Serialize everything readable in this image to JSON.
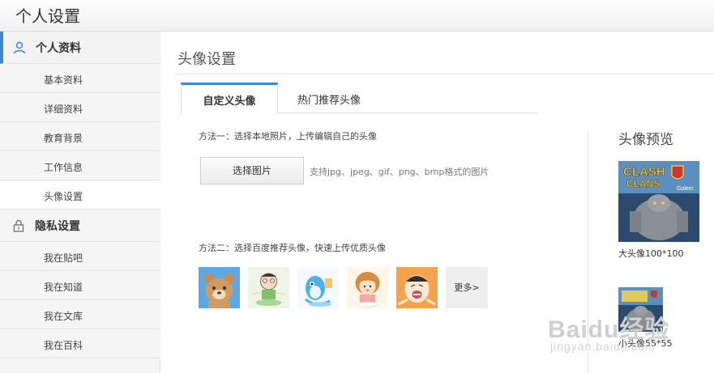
{
  "header": {
    "title": "个人设置"
  },
  "sidebar": {
    "sections": [
      {
        "label": "个人资料",
        "icon": "user-icon"
      },
      {
        "label": "隐私设置",
        "icon": "lock-icon"
      }
    ],
    "profile_items": [
      "基本资料",
      "详细资料",
      "教育背景",
      "工作信息",
      "头像设置"
    ],
    "privacy_items": [
      "我在贴吧",
      "我在知道",
      "我在文库",
      "我在百科"
    ],
    "selected": "头像设置"
  },
  "main": {
    "page_title": "头像设置",
    "tabs": [
      {
        "label": "自定义头像",
        "active": true
      },
      {
        "label": "热门推荐头像",
        "active": false
      }
    ],
    "method1": {
      "text": "方法一：选择本地照片，上传编辑自己的头像",
      "button": "选择图片",
      "support": "支持jpg、jpeg、gif、png、bmp格式的图片"
    },
    "method2": {
      "text": "方法二：选择百度推荐头像，快速上传优质头像",
      "more": "更多>"
    },
    "preview": {
      "title": "头像预览",
      "big_image_text_1": "CLASH",
      "big_image_text_2": "CLANS",
      "big_image_text_3": "Golem",
      "big_label": "大头像100*100",
      "small_label": "小头像55*55"
    }
  },
  "watermark": {
    "brand": "Baidu经验",
    "url": "jingyan.baidu.com"
  },
  "colors": {
    "accent": "#3b86d6",
    "sidebar_bg": "#f5f5f5"
  }
}
